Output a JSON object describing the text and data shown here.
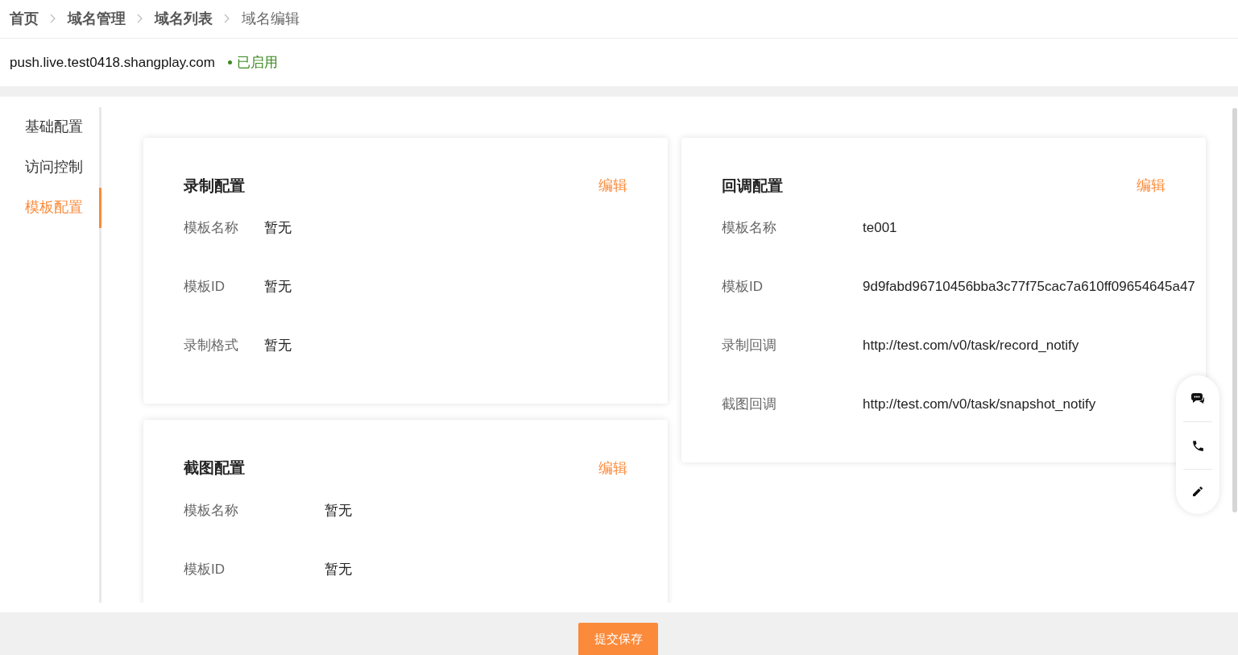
{
  "breadcrumb": [
    {
      "label": "首页",
      "current": false
    },
    {
      "label": "域名管理",
      "current": false
    },
    {
      "label": "域名列表",
      "current": false
    },
    {
      "label": "域名编辑",
      "current": true
    }
  ],
  "domain": {
    "name": "push.live.test0418.shangplay.com",
    "status": "已启用",
    "enabled": true
  },
  "nav": [
    {
      "label": "基础配置",
      "selected": false
    },
    {
      "label": "访问控制",
      "selected": false
    },
    {
      "label": "模板配置",
      "selected": true
    }
  ],
  "left_cards": [
    {
      "title": "录制配置",
      "edit": "编辑",
      "fields": [
        {
          "label": "模板名称",
          "value": "暂无"
        },
        {
          "label": "模板ID",
          "value": "暂无"
        },
        {
          "label": "录制格式",
          "value": "暂无"
        }
      ]
    },
    {
      "title": "截图配置",
      "edit": "编辑",
      "fields": [
        {
          "label": "模板名称",
          "value": "暂无"
        },
        {
          "label": "模板ID",
          "value": "暂无"
        }
      ]
    }
  ],
  "right_cards": [
    {
      "title": "回调配置",
      "edit": "编辑",
      "fields": [
        {
          "label": "模板名称",
          "value": "te001"
        },
        {
          "label": "模板ID",
          "value": "9d9fabd96710456bba3c77f75cac7a610ff09654645a47"
        },
        {
          "label": "录制回调",
          "value": "http://test.com/v0/task/record_notify"
        },
        {
          "label": "截图回调",
          "value": "http://test.com/v0/task/snapshot_notify"
        }
      ]
    }
  ],
  "submit_button": "提交保存"
}
